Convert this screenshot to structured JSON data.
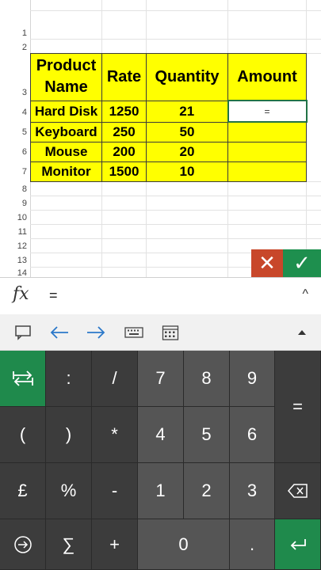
{
  "sheet": {
    "row_numbers": [
      "1",
      "2",
      "3",
      "4",
      "5",
      "6",
      "7",
      "8",
      "9",
      "10",
      "11",
      "12",
      "13",
      "14"
    ],
    "headers": [
      "Product Name",
      "Rate",
      "Quantity",
      "Amount"
    ],
    "rows": [
      {
        "product": "Hard Disk",
        "rate": "1250",
        "quantity": "21",
        "amount": "="
      },
      {
        "product": "Keyboard",
        "rate": "250",
        "quantity": "50",
        "amount": ""
      },
      {
        "product": "Mouse",
        "rate": "200",
        "quantity": "20",
        "amount": ""
      },
      {
        "product": "Monitor",
        "rate": "1500",
        "quantity": "10",
        "amount": ""
      }
    ],
    "active_cell_text": "=",
    "highlight_color": "#ffff00"
  },
  "entry": {
    "cancel_glyph": "✕",
    "confirm_glyph": "✓"
  },
  "formula_bar": {
    "fx_label": "fx",
    "text": "=",
    "collapse_glyph": "^"
  },
  "toolbar": {
    "icons": [
      "window-icon",
      "left-arrow-icon",
      "right-arrow-icon",
      "keyboard-icon",
      "calendar-icon",
      "expand-up-icon"
    ]
  },
  "keypad": {
    "keys": [
      {
        "label": "",
        "icon": "switch-keyboard-icon"
      },
      {
        "label": ":"
      },
      {
        "label": "/"
      },
      {
        "label": "7"
      },
      {
        "label": "8"
      },
      {
        "label": "9"
      },
      {
        "label": "="
      },
      {
        "label": "("
      },
      {
        "label": ")"
      },
      {
        "label": "*"
      },
      {
        "label": "4"
      },
      {
        "label": "5"
      },
      {
        "label": "6"
      },
      {
        "label": "£"
      },
      {
        "label": "%"
      },
      {
        "label": "-"
      },
      {
        "label": "1"
      },
      {
        "label": "2"
      },
      {
        "label": "3"
      },
      {
        "label": "",
        "icon": "backspace-icon"
      },
      {
        "label": "",
        "icon": "navigate-icon"
      },
      {
        "label": "∑"
      },
      {
        "label": "+"
      },
      {
        "label": "0"
      },
      {
        "label": "."
      },
      {
        "label": "",
        "icon": "enter-icon"
      }
    ]
  },
  "colors": {
    "accent": "#217346",
    "cancel": "#c8472a",
    "confirm": "#1e8f4e",
    "keypad_bg": "#3c3c3c",
    "num_key": "#555555"
  }
}
